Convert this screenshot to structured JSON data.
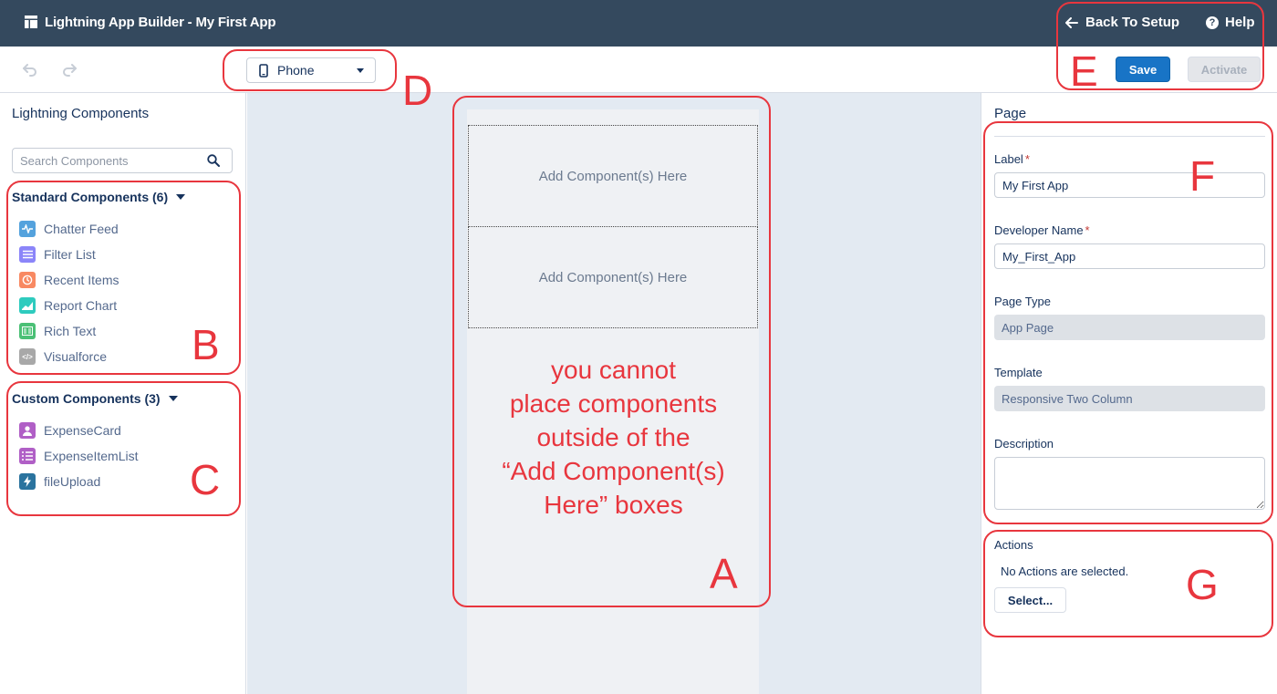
{
  "header": {
    "title": "Lightning App Builder - My First App",
    "back_label": "Back To Setup",
    "help_label": "Help",
    "background": "#34495e"
  },
  "toolbar": {
    "device": "Phone",
    "save_label": "Save",
    "activate_label": "Activate",
    "accent": "#1874c6"
  },
  "left_panel": {
    "title": "Lightning Components",
    "search_placeholder": "Search Components",
    "standard": {
      "title": "Standard Components (6)",
      "items": [
        {
          "label": "Chatter Feed",
          "icon": "chatter-feed-icon",
          "color": "#54a2dd"
        },
        {
          "label": "Filter List",
          "icon": "filter-list-icon",
          "color": "#8b85f9"
        },
        {
          "label": "Recent Items",
          "icon": "recent-items-icon",
          "color": "#f88962"
        },
        {
          "label": "Report Chart",
          "icon": "report-chart-icon",
          "color": "#2ecbbe"
        },
        {
          "label": "Rich Text",
          "icon": "rich-text-icon",
          "color": "#4bc076"
        },
        {
          "label": "Visualforce",
          "icon": "visualforce-icon",
          "color": "#a8a8a8"
        }
      ]
    },
    "custom": {
      "title": "Custom Components (3)",
      "items": [
        {
          "label": "ExpenseCard",
          "icon": "expense-card-icon",
          "color": "#b05fc6"
        },
        {
          "label": "ExpenseItemList",
          "icon": "expense-item-list-icon",
          "color": "#b05fc6"
        },
        {
          "label": "fileUpload",
          "icon": "file-upload-icon",
          "color": "#2a739e"
        }
      ]
    }
  },
  "canvas": {
    "drop_zones": [
      "Add Component(s) Here",
      "Add Component(s) Here"
    ]
  },
  "right_panel": {
    "title": "Page",
    "label_label": "Label",
    "label_value": "My First App",
    "dev_name_label": "Developer Name",
    "dev_name_value": "My_First_App",
    "page_type_label": "Page Type",
    "page_type_value": "App Page",
    "template_label": "Template",
    "template_value": "Responsive Two Column",
    "description_label": "Description",
    "actions_label": "Actions",
    "actions_empty": "No Actions are selected.",
    "select_label": "Select...",
    "required_mark": "*"
  },
  "annotations": {
    "color": "#e8363e",
    "letters": {
      "A": "A",
      "B": "B",
      "C": "C",
      "D": "D",
      "E": "E",
      "F": "F",
      "G": "G"
    },
    "note_lines": [
      "you cannot",
      "place components",
      "outside of the",
      "“Add Component(s)",
      "Here” boxes"
    ]
  }
}
